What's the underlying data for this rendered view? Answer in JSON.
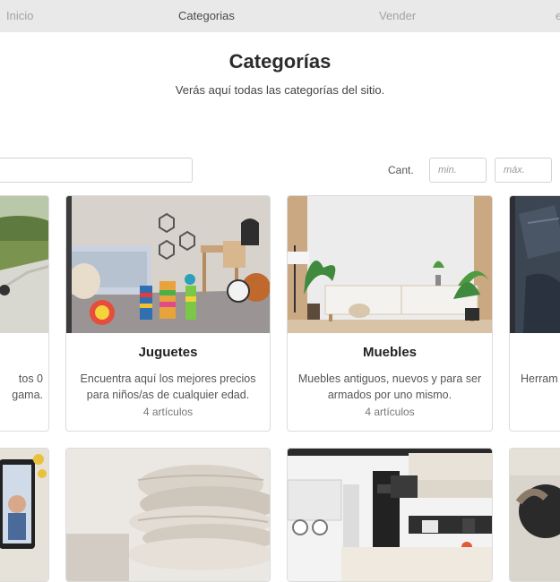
{
  "nav": {
    "items": [
      {
        "label": "Inicio"
      },
      {
        "label": "Categorias"
      },
      {
        "label": "Vender"
      },
      {
        "label": "e"
      }
    ]
  },
  "header": {
    "title": "Categorías",
    "subtitle": "Verás aquí todas las categorías del sitio."
  },
  "filters": {
    "search_placeholder": "",
    "cant_label": "Cant.",
    "min_placeholder": "min.",
    "max_placeholder": "máx."
  },
  "categories": [
    {
      "name": "",
      "description": "tos 0\ngama.",
      "count": ""
    },
    {
      "name": "Juguetes",
      "description": "Encuentra aquí los mejores precios para niños/as de cualquier edad.",
      "count": "4 artículos"
    },
    {
      "name": "Muebles",
      "description": "Muebles antiguos, nuevos y para ser armados por uno mismo.",
      "count": "4 artículos"
    },
    {
      "name": "",
      "description": "Herram",
      "count": ""
    }
  ]
}
